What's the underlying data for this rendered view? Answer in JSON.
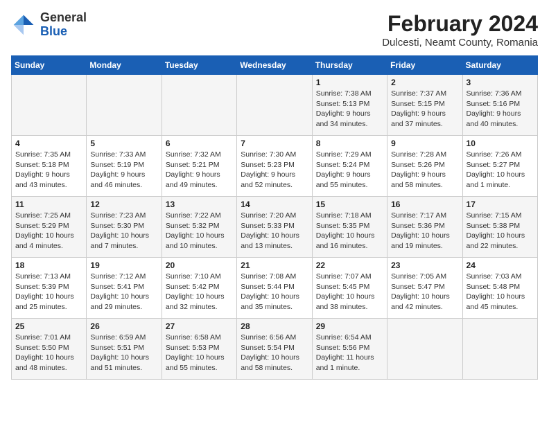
{
  "header": {
    "logo": {
      "general": "General",
      "blue": "Blue"
    },
    "title": "February 2024",
    "location": "Dulcesti, Neamt County, Romania"
  },
  "weekdays": [
    "Sunday",
    "Monday",
    "Tuesday",
    "Wednesday",
    "Thursday",
    "Friday",
    "Saturday"
  ],
  "weeks": [
    [
      {
        "day": "",
        "info": ""
      },
      {
        "day": "",
        "info": ""
      },
      {
        "day": "",
        "info": ""
      },
      {
        "day": "",
        "info": ""
      },
      {
        "day": "1",
        "info": "Sunrise: 7:38 AM\nSunset: 5:13 PM\nDaylight: 9 hours\nand 34 minutes."
      },
      {
        "day": "2",
        "info": "Sunrise: 7:37 AM\nSunset: 5:15 PM\nDaylight: 9 hours\nand 37 minutes."
      },
      {
        "day": "3",
        "info": "Sunrise: 7:36 AM\nSunset: 5:16 PM\nDaylight: 9 hours\nand 40 minutes."
      }
    ],
    [
      {
        "day": "4",
        "info": "Sunrise: 7:35 AM\nSunset: 5:18 PM\nDaylight: 9 hours\nand 43 minutes."
      },
      {
        "day": "5",
        "info": "Sunrise: 7:33 AM\nSunset: 5:19 PM\nDaylight: 9 hours\nand 46 minutes."
      },
      {
        "day": "6",
        "info": "Sunrise: 7:32 AM\nSunset: 5:21 PM\nDaylight: 9 hours\nand 49 minutes."
      },
      {
        "day": "7",
        "info": "Sunrise: 7:30 AM\nSunset: 5:23 PM\nDaylight: 9 hours\nand 52 minutes."
      },
      {
        "day": "8",
        "info": "Sunrise: 7:29 AM\nSunset: 5:24 PM\nDaylight: 9 hours\nand 55 minutes."
      },
      {
        "day": "9",
        "info": "Sunrise: 7:28 AM\nSunset: 5:26 PM\nDaylight: 9 hours\nand 58 minutes."
      },
      {
        "day": "10",
        "info": "Sunrise: 7:26 AM\nSunset: 5:27 PM\nDaylight: 10 hours\nand 1 minute."
      }
    ],
    [
      {
        "day": "11",
        "info": "Sunrise: 7:25 AM\nSunset: 5:29 PM\nDaylight: 10 hours\nand 4 minutes."
      },
      {
        "day": "12",
        "info": "Sunrise: 7:23 AM\nSunset: 5:30 PM\nDaylight: 10 hours\nand 7 minutes."
      },
      {
        "day": "13",
        "info": "Sunrise: 7:22 AM\nSunset: 5:32 PM\nDaylight: 10 hours\nand 10 minutes."
      },
      {
        "day": "14",
        "info": "Sunrise: 7:20 AM\nSunset: 5:33 PM\nDaylight: 10 hours\nand 13 minutes."
      },
      {
        "day": "15",
        "info": "Sunrise: 7:18 AM\nSunset: 5:35 PM\nDaylight: 10 hours\nand 16 minutes."
      },
      {
        "day": "16",
        "info": "Sunrise: 7:17 AM\nSunset: 5:36 PM\nDaylight: 10 hours\nand 19 minutes."
      },
      {
        "day": "17",
        "info": "Sunrise: 7:15 AM\nSunset: 5:38 PM\nDaylight: 10 hours\nand 22 minutes."
      }
    ],
    [
      {
        "day": "18",
        "info": "Sunrise: 7:13 AM\nSunset: 5:39 PM\nDaylight: 10 hours\nand 25 minutes."
      },
      {
        "day": "19",
        "info": "Sunrise: 7:12 AM\nSunset: 5:41 PM\nDaylight: 10 hours\nand 29 minutes."
      },
      {
        "day": "20",
        "info": "Sunrise: 7:10 AM\nSunset: 5:42 PM\nDaylight: 10 hours\nand 32 minutes."
      },
      {
        "day": "21",
        "info": "Sunrise: 7:08 AM\nSunset: 5:44 PM\nDaylight: 10 hours\nand 35 minutes."
      },
      {
        "day": "22",
        "info": "Sunrise: 7:07 AM\nSunset: 5:45 PM\nDaylight: 10 hours\nand 38 minutes."
      },
      {
        "day": "23",
        "info": "Sunrise: 7:05 AM\nSunset: 5:47 PM\nDaylight: 10 hours\nand 42 minutes."
      },
      {
        "day": "24",
        "info": "Sunrise: 7:03 AM\nSunset: 5:48 PM\nDaylight: 10 hours\nand 45 minutes."
      }
    ],
    [
      {
        "day": "25",
        "info": "Sunrise: 7:01 AM\nSunset: 5:50 PM\nDaylight: 10 hours\nand 48 minutes."
      },
      {
        "day": "26",
        "info": "Sunrise: 6:59 AM\nSunset: 5:51 PM\nDaylight: 10 hours\nand 51 minutes."
      },
      {
        "day": "27",
        "info": "Sunrise: 6:58 AM\nSunset: 5:53 PM\nDaylight: 10 hours\nand 55 minutes."
      },
      {
        "day": "28",
        "info": "Sunrise: 6:56 AM\nSunset: 5:54 PM\nDaylight: 10 hours\nand 58 minutes."
      },
      {
        "day": "29",
        "info": "Sunrise: 6:54 AM\nSunset: 5:56 PM\nDaylight: 11 hours\nand 1 minute."
      },
      {
        "day": "",
        "info": ""
      },
      {
        "day": "",
        "info": ""
      }
    ]
  ]
}
